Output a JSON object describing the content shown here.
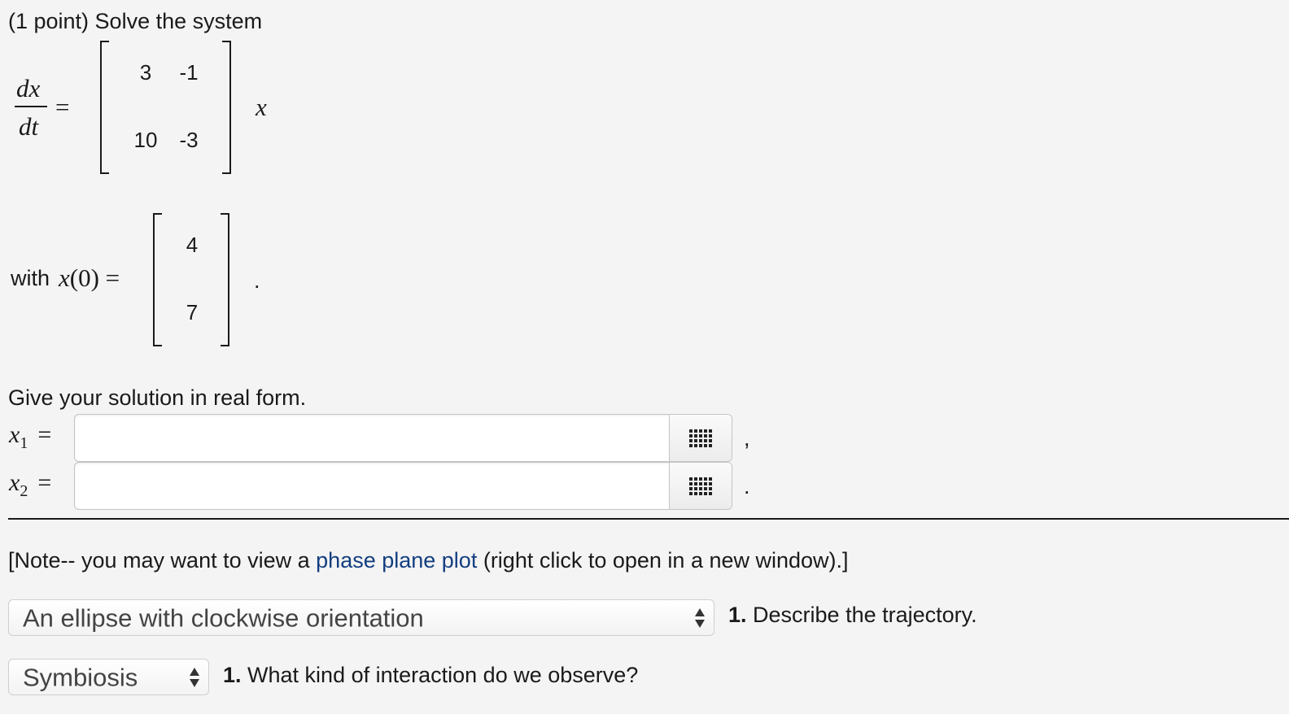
{
  "problem": {
    "header": "(1 point) Solve the system",
    "ode_numerator": "dx",
    "ode_denominator": "dt",
    "equals": "=",
    "matrix": [
      [
        "3",
        "-1"
      ],
      [
        "10",
        "-3"
      ]
    ],
    "vector_symbol": "x",
    "with_text": "with",
    "initial_label": "x(0) =",
    "initial_vector": [
      "4",
      "7"
    ],
    "period": "."
  },
  "answer": {
    "instruction": "Give your solution in real form.",
    "fields": [
      {
        "var": "x",
        "sub": "1",
        "eq": "=",
        "value": "",
        "trail": ","
      },
      {
        "var": "x",
        "sub": "2",
        "eq": "=",
        "value": "",
        "trail": "."
      }
    ],
    "keyboard_icon": "grid-keyboard-icon"
  },
  "note": {
    "prefix": "[Note-- you may want to view a ",
    "link_text": "phase plane plot",
    "suffix": " (right click to open in a new window).]"
  },
  "questions": [
    {
      "selected": "An ellipse with clockwise orientation",
      "number": "1.",
      "text": " Describe the trajectory."
    },
    {
      "selected": "Symbiosis",
      "number": "1.",
      "text": " What kind of interaction do we observe?"
    }
  ],
  "colors": {
    "background": "#f4f4f4",
    "link": "#133e80",
    "text": "#1a1a1a"
  }
}
